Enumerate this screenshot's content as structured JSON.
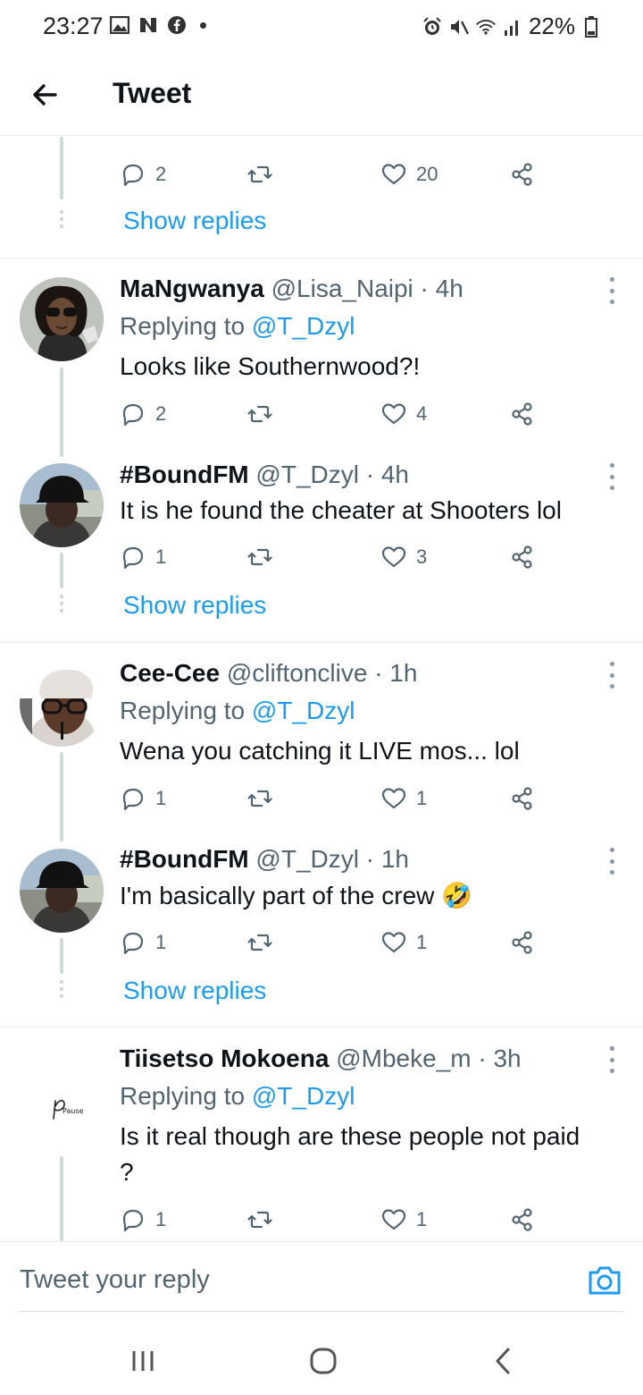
{
  "status_bar": {
    "time": "23:27",
    "battery": "22%",
    "left_icons": [
      "gallery-icon",
      "n-icon",
      "facebook-icon"
    ],
    "right_icons": [
      "alarm-icon",
      "mute-icon",
      "wifi-icon",
      "signal-icon",
      "battery-icon"
    ]
  },
  "header": {
    "title": "Tweet",
    "back_icon": "arrow-left-icon"
  },
  "top_partial": {
    "reply_count": "2",
    "like_count": "20",
    "show_replies": "Show replies"
  },
  "tweets": [
    {
      "name": "MaNgwanya",
      "meta": " @Lisa_Naipi · 4h",
      "replying_label": "Replying to ",
      "replying_to": "@T_Dzyl",
      "text": "Looks like Southernwood?!",
      "replies": "2",
      "likes": "4"
    },
    {
      "name": "#BoundFM",
      "meta": " @T_Dzyl · 4h",
      "text": "It is he found the cheater at Shooters lol",
      "replies": "1",
      "likes": "3",
      "show_replies": "Show replies"
    },
    {
      "name": "Cee-Cee",
      "meta": " @cliftonclive · 1h",
      "replying_label": "Replying to ",
      "replying_to": "@T_Dzyl",
      "text": "Wena you catching it LIVE mos... lol",
      "replies": "1",
      "likes": "1"
    },
    {
      "name": "#BoundFM",
      "meta": " @T_Dzyl · 1h",
      "text": "I'm basically part of the crew 🤣",
      "replies": "1",
      "likes": "1",
      "show_replies": "Show replies"
    },
    {
      "name": "Tiisetso Mokoena",
      "meta": " @Mbeke_m · 3h",
      "replying_label": "Replying to ",
      "replying_to": "@T_Dzyl",
      "text": "Is it real though are these people not paid ?",
      "replies": "1",
      "likes": "1",
      "avatar_text": "Pause"
    }
  ],
  "composer": {
    "placeholder": "Tweet your reply",
    "camera_icon": "camera-icon"
  },
  "nav": {
    "icons": [
      "recents-icon",
      "home-icon",
      "back-icon"
    ]
  },
  "colors": {
    "accent": "#1d9bf0",
    "text": "#0f1419",
    "muted": "#536471",
    "divider": "#e6ecf0"
  }
}
